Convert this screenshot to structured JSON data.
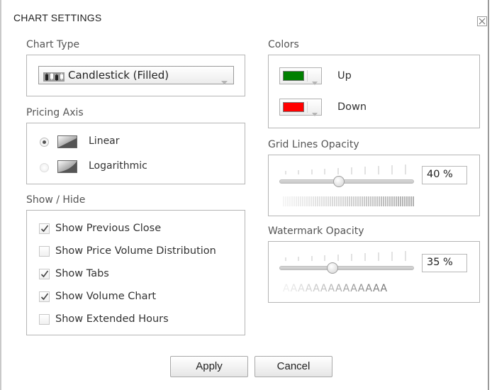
{
  "dialog": {
    "title": "CHART SETTINGS",
    "close_icon": "close-icon"
  },
  "chart_type": {
    "label": "Chart Type",
    "selected": "Candlestick (Filled)",
    "icon": "candlestick-icon"
  },
  "pricing_axis": {
    "label": "Pricing Axis",
    "options": [
      {
        "label": "Linear",
        "selected": true,
        "icon": "linear-axis-icon"
      },
      {
        "label": "Logarithmic",
        "selected": false,
        "icon": "logarithmic-axis-icon"
      }
    ]
  },
  "show_hide": {
    "label": "Show / Hide",
    "items": [
      {
        "label": "Show Previous Close",
        "checked": true
      },
      {
        "label": "Show Price Volume Distribution",
        "checked": false
      },
      {
        "label": "Show Tabs",
        "checked": true
      },
      {
        "label": "Show Volume Chart",
        "checked": true
      },
      {
        "label": "Show Extended Hours",
        "checked": false
      }
    ]
  },
  "colors": {
    "label": "Colors",
    "up": {
      "label": "Up",
      "color": "#008000"
    },
    "down": {
      "label": "Down",
      "color": "#ff0000"
    }
  },
  "grid_lines_opacity": {
    "label": "Grid Lines Opacity",
    "value_text": "40 %",
    "value": 0.4
  },
  "watermark_opacity": {
    "label": "Watermark Opacity",
    "value_text": "35 %",
    "value": 0.35,
    "preview_text": "AAAAAAAAAAAAAA"
  },
  "buttons": {
    "apply": "Apply",
    "cancel": "Cancel"
  }
}
